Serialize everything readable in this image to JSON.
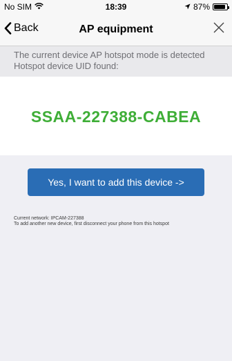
{
  "status": {
    "carrier": "No SIM",
    "time": "18:39",
    "battery_text": "87%",
    "battery_level": 0.87
  },
  "nav": {
    "back_label": "Back",
    "title": "AP equipment"
  },
  "info": {
    "line1": "The current device AP hotspot mode is detected",
    "line2": "Hotspot device UID found:"
  },
  "uid": "SSAA-227388-CABEA",
  "add_button_label": "Yes, I want to add this device ->",
  "notes": {
    "network": "Current network: IPCAM-227388",
    "instruction": "To add another new device, first disconnect your phone from this hotspot"
  },
  "colors": {
    "uid": "#3fae37",
    "button": "#2a6db5"
  }
}
